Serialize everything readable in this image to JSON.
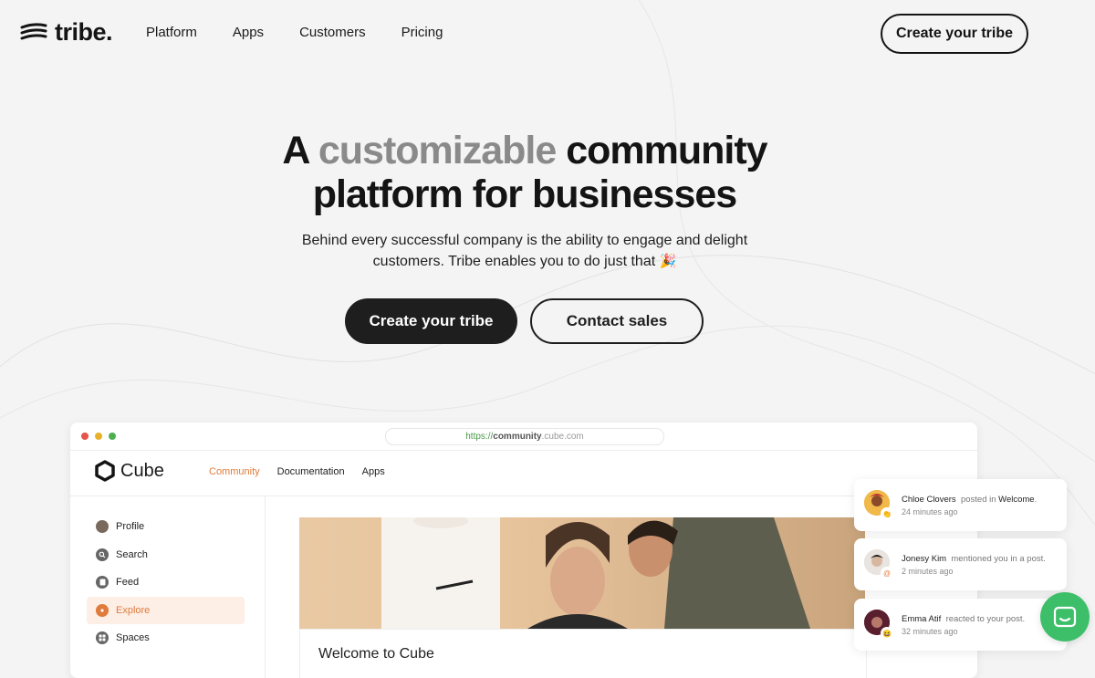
{
  "brand": {
    "name": "tribe."
  },
  "nav": {
    "links": [
      "Platform",
      "Apps",
      "Customers",
      "Pricing"
    ],
    "cta": "Create your tribe"
  },
  "hero": {
    "title_a": "A",
    "title_muted": "customizable",
    "title_b": "community",
    "title_line2": "platform for businesses",
    "subtitle_line1": "Behind every successful company is the ability to engage and delight",
    "subtitle_line2": "customers. Tribe enables you to do just that",
    "subtitle_emoji": "🎉",
    "primary_cta": "Create your tribe",
    "secondary_cta": "Contact sales"
  },
  "browser": {
    "url_scheme": "https://",
    "url_host": "community",
    "url_rest": ".cube.com"
  },
  "app": {
    "name": "Cube",
    "nav": [
      "Community",
      "Documentation",
      "Apps"
    ],
    "active_nav": "Community",
    "sidebar": [
      {
        "label": "Profile",
        "icon": "avatar-icon"
      },
      {
        "label": "Search",
        "icon": "search-icon"
      },
      {
        "label": "Feed",
        "icon": "feed-icon"
      },
      {
        "label": "Explore",
        "icon": "compass-icon",
        "active": true
      },
      {
        "label": "Spaces",
        "icon": "grid-icon"
      }
    ],
    "welcome": "Welcome to Cube"
  },
  "notifications": [
    {
      "name": "Chloe Clovers",
      "action": "posted in",
      "target": "Welcome",
      "suffix": ".",
      "time": "24 minutes ago"
    },
    {
      "name": "Jonesy Kim",
      "action": "mentioned you in a post.",
      "target": "",
      "suffix": "",
      "time": "2 minutes ago"
    },
    {
      "name": "Emma Atif",
      "action": "reacted to your post.",
      "target": "",
      "suffix": "",
      "time": "32 minutes ago"
    }
  ],
  "colors": {
    "accent": "#e07b3c",
    "chat": "#3dbf6a",
    "dark": "#1e1e1e"
  }
}
